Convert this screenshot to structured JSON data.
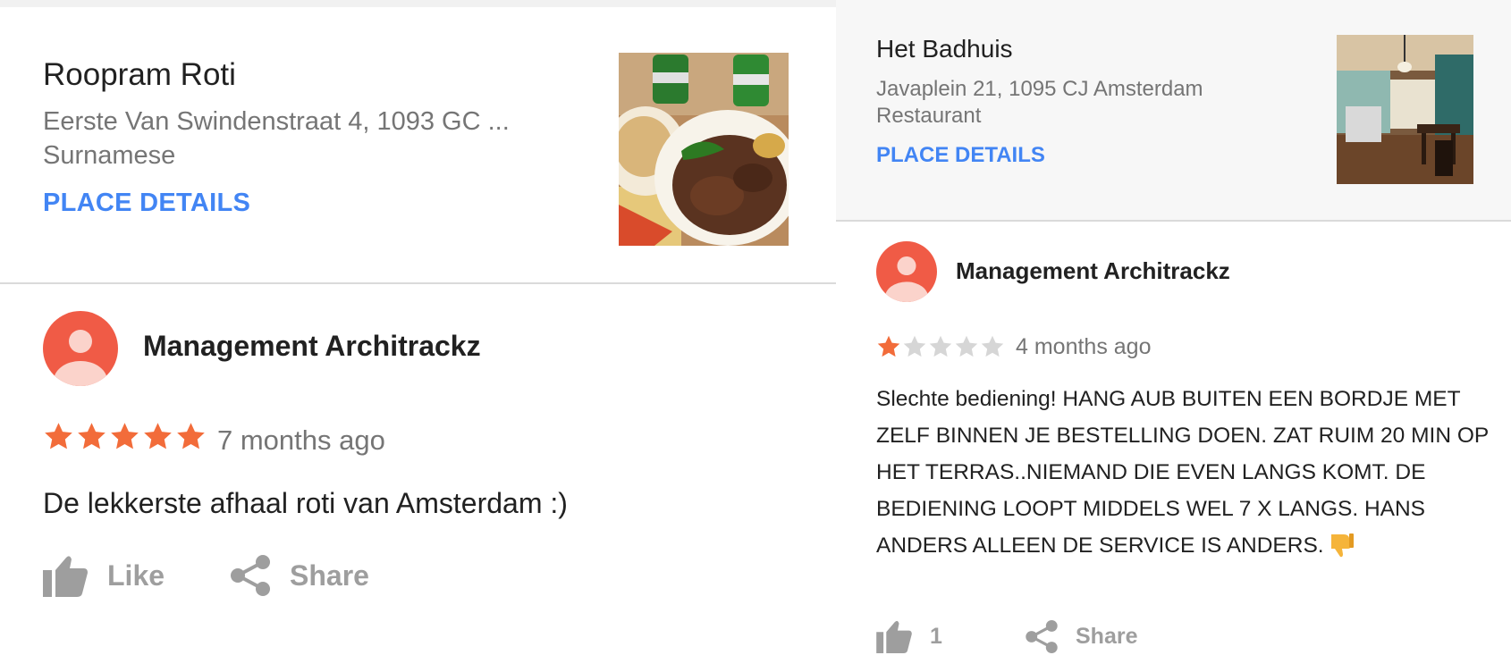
{
  "left": {
    "place": {
      "name": "Roopram Roti",
      "address": "Eerste Van Swindenstraat 4, 1093 GC ...",
      "category": "Surnamese",
      "details_label": "PLACE DETAILS"
    },
    "review": {
      "reviewer": "Management Architrackz",
      "rating": 5,
      "rating_max": 5,
      "age": "7 months ago",
      "text": "De lekkerste afhaal roti van Amsterdam :)",
      "like_label": "Like",
      "share_label": "Share"
    }
  },
  "right": {
    "place": {
      "name": "Het Badhuis",
      "address": "Javaplein 21, 1095 CJ Amsterdam",
      "category": "Restaurant",
      "details_label": "PLACE DETAILS"
    },
    "review": {
      "reviewer": "Management Architrackz",
      "rating": 1,
      "rating_max": 5,
      "age": "4 months ago",
      "text": "Slechte bediening! HANG AUB BUITEN EEN BORDJE MET ZELF BINNEN JE BESTELLING DOEN. ZAT RUIM 20 MIN OP HET TERRAS..NIEMAND DIE EVEN LANGS KOMT. DE BEDIENING LOOPT MIDDELS WEL 7 X LANGS. HANS ANDERS ALLEEN DE SERVICE IS ANDERS.",
      "like_count": "1",
      "share_label": "Share"
    }
  },
  "icons": {
    "avatar": "person-avatar-icon",
    "star": "star-icon",
    "like": "thumbs-up-icon",
    "share": "share-icon",
    "emoji": "thumbs-down-emoji"
  },
  "colors": {
    "accent_blue": "#4285f4",
    "star_filled": "#f26c3a",
    "star_empty": "#d6d6d6",
    "avatar": "#f05b46",
    "secondary_text": "#757575",
    "action_gray": "#9e9e9e"
  }
}
